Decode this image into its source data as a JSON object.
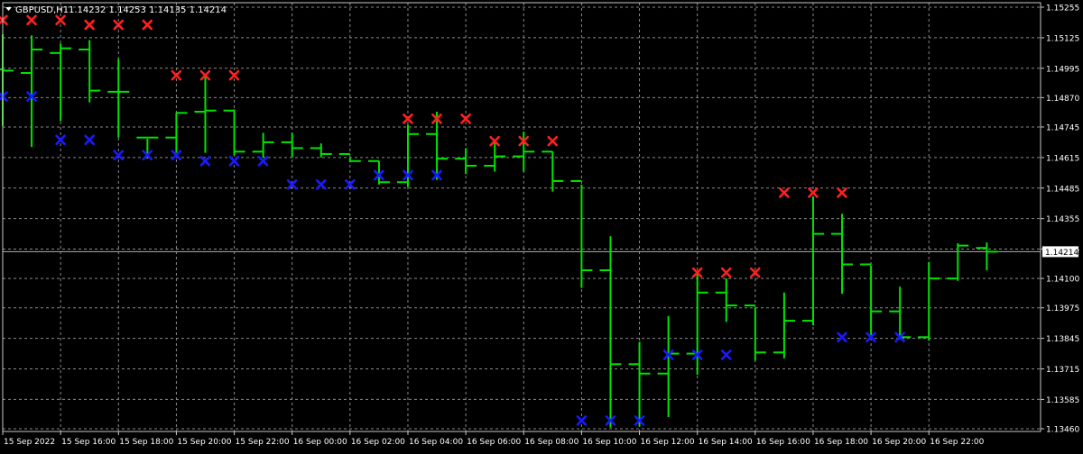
{
  "header": {
    "symbol": "GBPUSD,H1",
    "ohlc": "1.14232 1.14253 1.14135 1.14214"
  },
  "colors": {
    "background": "#000000",
    "grid": "#8a8a8a",
    "axis": "#c8c8c8",
    "text": "#ffffff",
    "bars": "#00e400",
    "upper_marker": "#ff2020",
    "lower_marker": "#1a1aff",
    "price_line": "#b0b0b0"
  },
  "chart_data": {
    "type": "ohlc",
    "symbol": "GBPUSD",
    "timeframe": "H1",
    "ylim": [
      1.1346,
      1.15255
    ],
    "current_price": "1.14214",
    "current_price_value": 1.14214,
    "grid": true,
    "y_ticks": [
      "1.15255",
      "1.15125",
      "1.14995",
      "1.14870",
      "1.14745",
      "1.14615",
      "1.14485",
      "1.14355",
      "1.14225",
      "1.14100",
      "1.13975",
      "1.13845",
      "1.13715",
      "1.13585",
      "1.13460"
    ],
    "x_ticks": [
      "15 Sep 2022",
      "15 Sep 16:00",
      "15 Sep 18:00",
      "15 Sep 20:00",
      "15 Sep 22:00",
      "16 Sep 00:00",
      "16 Sep 02:00",
      "16 Sep 04:00",
      "16 Sep 06:00",
      "16 Sep 08:00",
      "16 Sep 10:00",
      "16 Sep 12:00",
      "16 Sep 14:00",
      "16 Sep 16:00",
      "16 Sep 18:00",
      "16 Sep 20:00",
      "16 Sep 22:00"
    ],
    "bars": [
      {
        "o": 1.1499,
        "h": 1.1514,
        "l": 1.1475,
        "c": 1.14985
      },
      {
        "o": 1.14975,
        "h": 1.15135,
        "l": 1.1466,
        "c": 1.15075
      },
      {
        "o": 1.1506,
        "h": 1.151,
        "l": 1.1477,
        "c": 1.1508
      },
      {
        "o": 1.15075,
        "h": 1.15115,
        "l": 1.1485,
        "c": 1.149
      },
      {
        "o": 1.14895,
        "h": 1.15035,
        "l": 1.147,
        "c": 1.14895
      },
      {
        "o": 1.147,
        "h": 1.14695,
        "l": 1.1461,
        "c": 1.147
      },
      {
        "o": 1.147,
        "h": 1.14805,
        "l": 1.14635,
        "c": 1.14805
      },
      {
        "o": 1.1481,
        "h": 1.1497,
        "l": 1.14635,
        "c": 1.14815
      },
      {
        "o": 1.14815,
        "h": 1.1482,
        "l": 1.14625,
        "c": 1.1464
      },
      {
        "o": 1.1464,
        "h": 1.1472,
        "l": 1.14615,
        "c": 1.1468
      },
      {
        "o": 1.1468,
        "h": 1.1472,
        "l": 1.14615,
        "c": 1.14655
      },
      {
        "o": 1.14655,
        "h": 1.14675,
        "l": 1.14615,
        "c": 1.1463
      },
      {
        "o": 1.1463,
        "h": 1.14615,
        "l": 1.14595,
        "c": 1.146
      },
      {
        "o": 1.146,
        "h": 1.146,
        "l": 1.145,
        "c": 1.1451
      },
      {
        "o": 1.1451,
        "h": 1.14755,
        "l": 1.1449,
        "c": 1.14715
      },
      {
        "o": 1.14715,
        "h": 1.1481,
        "l": 1.1452,
        "c": 1.1461
      },
      {
        "o": 1.1461,
        "h": 1.14655,
        "l": 1.14545,
        "c": 1.1458
      },
      {
        "o": 1.1458,
        "h": 1.1468,
        "l": 1.14555,
        "c": 1.1462
      },
      {
        "o": 1.1462,
        "h": 1.14725,
        "l": 1.14555,
        "c": 1.1464
      },
      {
        "o": 1.1464,
        "h": 1.1464,
        "l": 1.1447,
        "c": 1.14515
      },
      {
        "o": 1.14515,
        "h": 1.145,
        "l": 1.1406,
        "c": 1.14135
      },
      {
        "o": 1.14135,
        "h": 1.1428,
        "l": 1.13465,
        "c": 1.13735
      },
      {
        "o": 1.13735,
        "h": 1.1383,
        "l": 1.1347,
        "c": 1.13695
      },
      {
        "o": 1.13695,
        "h": 1.1394,
        "l": 1.1351,
        "c": 1.1378
      },
      {
        "o": 1.1378,
        "h": 1.1413,
        "l": 1.1369,
        "c": 1.1404
      },
      {
        "o": 1.1404,
        "h": 1.141,
        "l": 1.13915,
        "c": 1.13985
      },
      {
        "o": 1.13985,
        "h": 1.13975,
        "l": 1.1375,
        "c": 1.13785
      },
      {
        "o": 1.13785,
        "h": 1.1404,
        "l": 1.1376,
        "c": 1.1392
      },
      {
        "o": 1.1392,
        "h": 1.1445,
        "l": 1.139,
        "c": 1.1429
      },
      {
        "o": 1.1429,
        "h": 1.14375,
        "l": 1.14035,
        "c": 1.1416
      },
      {
        "o": 1.1416,
        "h": 1.14155,
        "l": 1.1386,
        "c": 1.1396
      },
      {
        "o": 1.1396,
        "h": 1.14065,
        "l": 1.1384,
        "c": 1.1385
      },
      {
        "o": 1.1385,
        "h": 1.1417,
        "l": 1.13835,
        "c": 1.141
      },
      {
        "o": 1.141,
        "h": 1.1425,
        "l": 1.1409,
        "c": 1.1424
      },
      {
        "o": 1.1423,
        "h": 1.14253,
        "l": 1.14135,
        "c": 1.14214
      }
    ],
    "upper_markers": [
      {
        "bar": -1,
        "price": 1.152
      },
      {
        "bar": 0,
        "price": 1.152
      },
      {
        "bar": 1,
        "price": 1.152
      },
      {
        "bar": 2,
        "price": 1.1518
      },
      {
        "bar": 3,
        "price": 1.1518
      },
      {
        "bar": 4,
        "price": 1.1518
      },
      {
        "bar": 5,
        "price": 1.14965
      },
      {
        "bar": 6,
        "price": 1.14965
      },
      {
        "bar": 7,
        "price": 1.14965
      },
      {
        "bar": 13,
        "price": 1.1478
      },
      {
        "bar": 14,
        "price": 1.1478
      },
      {
        "bar": 15,
        "price": 1.1478
      },
      {
        "bar": 16,
        "price": 1.14685
      },
      {
        "bar": 17,
        "price": 1.14685
      },
      {
        "bar": 18,
        "price": 1.14685
      },
      {
        "bar": 23,
        "price": 1.14125
      },
      {
        "bar": 24,
        "price": 1.14125
      },
      {
        "bar": 25,
        "price": 1.14125
      },
      {
        "bar": 26,
        "price": 1.14465
      },
      {
        "bar": 27,
        "price": 1.14465
      },
      {
        "bar": 28,
        "price": 1.14465
      }
    ],
    "lower_markers": [
      {
        "bar": -1,
        "price": 1.14875
      },
      {
        "bar": 0,
        "price": 1.14875
      },
      {
        "bar": 1,
        "price": 1.1469
      },
      {
        "bar": 2,
        "price": 1.1469
      },
      {
        "bar": 3,
        "price": 1.14625
      },
      {
        "bar": 4,
        "price": 1.14625
      },
      {
        "bar": 5,
        "price": 1.14625
      },
      {
        "bar": 6,
        "price": 1.146
      },
      {
        "bar": 7,
        "price": 1.146
      },
      {
        "bar": 8,
        "price": 1.146
      },
      {
        "bar": 9,
        "price": 1.145
      },
      {
        "bar": 10,
        "price": 1.145
      },
      {
        "bar": 11,
        "price": 1.145
      },
      {
        "bar": 12,
        "price": 1.1454
      },
      {
        "bar": 13,
        "price": 1.1454
      },
      {
        "bar": 14,
        "price": 1.1454
      },
      {
        "bar": 19,
        "price": 1.13495
      },
      {
        "bar": 20,
        "price": 1.13495
      },
      {
        "bar": 21,
        "price": 1.13495
      },
      {
        "bar": 22,
        "price": 1.13775
      },
      {
        "bar": 23,
        "price": 1.13775
      },
      {
        "bar": 24,
        "price": 1.13775
      },
      {
        "bar": 28,
        "price": 1.1385
      },
      {
        "bar": 29,
        "price": 1.1385
      },
      {
        "bar": 30,
        "price": 1.1385
      }
    ]
  }
}
